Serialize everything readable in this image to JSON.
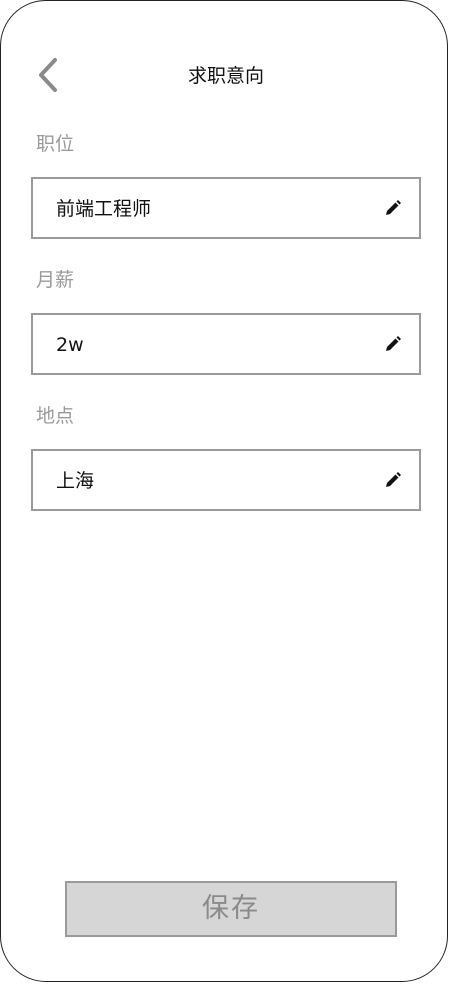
{
  "header": {
    "title": "求职意向",
    "back_icon": "chevron-left-icon"
  },
  "fields": [
    {
      "label": "职位",
      "value": "前端工程师",
      "icon": "pencil-icon"
    },
    {
      "label": "月薪",
      "value": "2w",
      "icon": "pencil-icon"
    },
    {
      "label": "地点",
      "value": "上海",
      "icon": "pencil-icon"
    }
  ],
  "footer": {
    "save_label": "保存"
  },
  "colors": {
    "frame_border": "#222222",
    "field_border": "#9a9a9a",
    "label_text": "#9a9a9a",
    "button_bg": "#d6d6d6",
    "button_text": "#8a8a8a"
  }
}
